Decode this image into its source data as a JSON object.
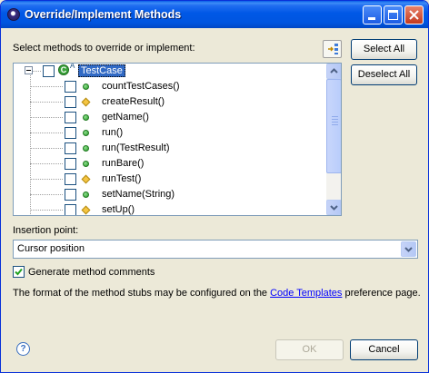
{
  "window": {
    "title": "Override/Implement Methods"
  },
  "methods": {
    "prompt": "Select methods to override or implement:",
    "select_all_label": "Select All",
    "deselect_all_label": "Deselect All",
    "root": {
      "label": "TestCase",
      "badge": "A"
    },
    "items": [
      {
        "label": "countTestCases()",
        "visibility": "public"
      },
      {
        "label": "createResult()",
        "visibility": "protected"
      },
      {
        "label": "getName()",
        "visibility": "public"
      },
      {
        "label": "run()",
        "visibility": "public"
      },
      {
        "label": "run(TestResult)",
        "visibility": "public"
      },
      {
        "label": "runBare()",
        "visibility": "public"
      },
      {
        "label": "runTest()",
        "visibility": "protected"
      },
      {
        "label": "setName(String)",
        "visibility": "public"
      },
      {
        "label": "setUp()",
        "visibility": "protected"
      }
    ]
  },
  "insertion": {
    "label": "Insertion point:",
    "selected": "Cursor position"
  },
  "comments": {
    "label": "Generate method comments",
    "checked": true
  },
  "info": {
    "prefix": "The format of the method stubs may be configured on the ",
    "link": "Code Templates",
    "suffix": " preference page."
  },
  "footer": {
    "ok_label": "OK",
    "cancel_label": "Cancel"
  },
  "colors": {
    "title_bar": "#0054e3",
    "link": "#0000ff",
    "selection": "#316ac5"
  }
}
